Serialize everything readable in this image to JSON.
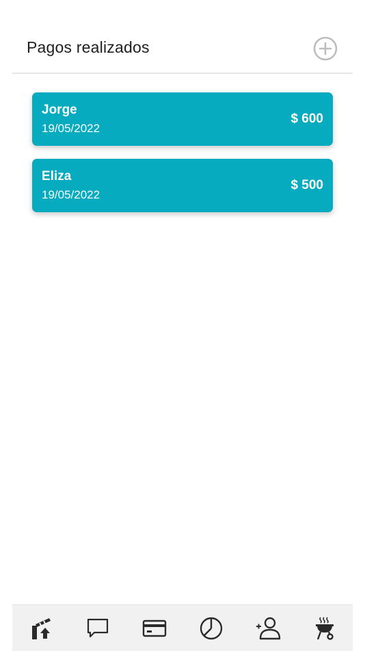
{
  "header": {
    "title": "Pagos realizados",
    "add_icon": "plus-circle-icon"
  },
  "payments": [
    {
      "name": "Jorge",
      "date": "19/05/2022",
      "amount": "$ 600"
    },
    {
      "name": "Eliza",
      "date": "19/05/2022",
      "amount": "$ 500"
    }
  ],
  "colors": {
    "card_background": "#06abbf",
    "card_text": "#ffffff",
    "nav_background": "#f1f1f1",
    "icon_color": "#2a2a2a",
    "add_icon_color": "#bdbdbd"
  },
  "bottom_nav": {
    "items": [
      {
        "icon": "barrier-gate-icon"
      },
      {
        "icon": "chat-bubble-icon"
      },
      {
        "icon": "credit-card-icon"
      },
      {
        "icon": "pie-chart-icon"
      },
      {
        "icon": "add-user-icon"
      },
      {
        "icon": "grill-icon"
      }
    ]
  }
}
